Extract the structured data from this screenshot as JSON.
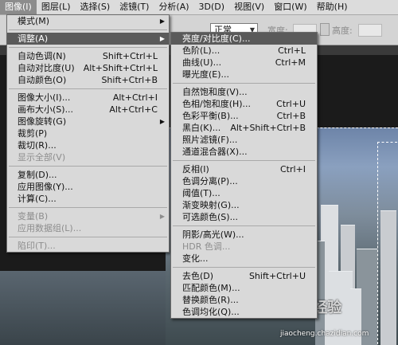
{
  "menubar": [
    "图像(I)",
    "图层(L)",
    "选择(S)",
    "滤镜(T)",
    "分析(A)",
    "3D(D)",
    "视图(V)",
    "窗口(W)",
    "帮助(H)"
  ],
  "options": {
    "mode_value": "正常",
    "width_label": "宽度:",
    "height_label": "高度:"
  },
  "image_menu": {
    "mode": "模式(M)",
    "adjust": "调整(A)",
    "auto_tone": {
      "label": "自动色调(N)",
      "shortcut": "Shift+Ctrl+L"
    },
    "auto_contrast": {
      "label": "自动对比度(U)",
      "shortcut": "Alt+Shift+Ctrl+L"
    },
    "auto_color": {
      "label": "自动颜色(O)",
      "shortcut": "Shift+Ctrl+B"
    },
    "image_size": {
      "label": "图像大小(I)...",
      "shortcut": "Alt+Ctrl+I"
    },
    "canvas_size": {
      "label": "画布大小(S)...",
      "shortcut": "Alt+Ctrl+C"
    },
    "rotation": "图像旋转(G)",
    "crop": "裁剪(P)",
    "trim": "裁切(R)...",
    "reveal_all": "显示全部(V)",
    "duplicate": "复制(D)...",
    "apply_image": "应用图像(Y)...",
    "calculations": "计算(C)...",
    "variables": "变量(B)",
    "apply_dataset": "应用数据组(L)...",
    "trap": "陷印(T)..."
  },
  "adjust_menu": {
    "brightness": "亮度/对比度(C)...",
    "levels": {
      "label": "色阶(L)...",
      "shortcut": "Ctrl+L"
    },
    "curves": {
      "label": "曲线(U)...",
      "shortcut": "Ctrl+M"
    },
    "exposure": "曝光度(E)...",
    "vibrance": "自然饱和度(V)...",
    "hue_sat": {
      "label": "色相/饱和度(H)...",
      "shortcut": "Ctrl+U"
    },
    "color_balance": {
      "label": "色彩平衡(B)...",
      "shortcut": "Ctrl+B"
    },
    "black_white": {
      "label": "黑白(K)...",
      "shortcut": "Alt+Shift+Ctrl+B"
    },
    "photo_filter": "照片滤镜(F)...",
    "channel_mixer": "通道混合器(X)...",
    "invert": {
      "label": "反相(I)",
      "shortcut": "Ctrl+I"
    },
    "posterize": "色调分离(P)...",
    "threshold": "阈值(T)...",
    "gradient_map": "渐变映射(G)...",
    "selective_color": "可选颜色(S)...",
    "shadows_highlights": "阴影/高光(W)...",
    "hdr_toning": "HDR 色调...",
    "variations": "变化...",
    "desaturate": {
      "label": "去色(D)",
      "shortcut": "Shift+Ctrl+U"
    },
    "match_color": "匹配颜色(M)...",
    "replace_color": "替换颜色(R)...",
    "equalize": "色调均化(Q)..."
  },
  "watermark": {
    "text": "Bai 经验",
    "url": "jiaocheng.chazidian.com"
  }
}
